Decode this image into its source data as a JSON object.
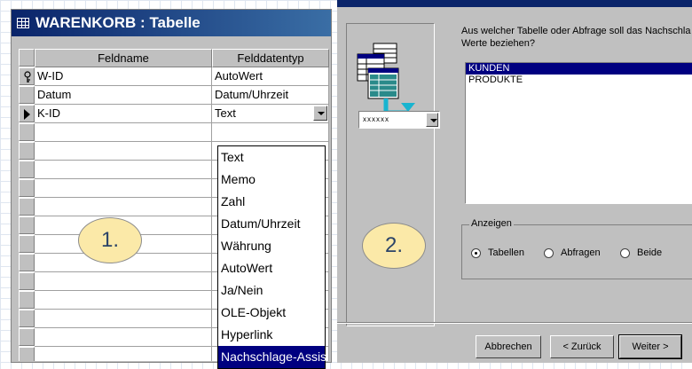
{
  "table_window": {
    "title": "WARENKORB : Tabelle",
    "columns": [
      "Feldname",
      "Felddatentyp"
    ],
    "rows": [
      {
        "feldname": "W-ID",
        "typ": "AutoWert",
        "primary_key": true
      },
      {
        "feldname": "Datum",
        "typ": "Datum/Uhrzeit",
        "primary_key": false
      },
      {
        "feldname": "K-ID",
        "typ": "Text",
        "primary_key": false,
        "current": true
      }
    ],
    "type_options": [
      "Text",
      "Memo",
      "Zahl",
      "Datum/Uhrzeit",
      "Währung",
      "AutoWert",
      "Ja/Nein",
      "OLE-Objekt",
      "Hyperlink",
      "Nachschlage-Assis"
    ],
    "highlighted_option": "Nachschlage-Assis"
  },
  "wizard": {
    "question": "Aus welcher Tabelle oder Abfrage soll das Nachschla Werte beziehen?",
    "list_items": [
      "KUNDEN",
      "PRODUKTE"
    ],
    "selected_item": "KUNDEN",
    "combo_placeholder": "xxxxxx",
    "group_label": "Anzeigen",
    "radio_options": [
      {
        "label": "Tabellen",
        "checked": true
      },
      {
        "label": "Abfragen",
        "checked": false
      },
      {
        "label": "Beide",
        "checked": false
      }
    ],
    "buttons": {
      "cancel": "Abbrechen",
      "back": "< Zurück",
      "next": "Weiter >"
    }
  },
  "badges": [
    "1.",
    "2."
  ],
  "colors": {
    "title_bar": "#0a246a",
    "selection": "#000080",
    "badge_fill": "#fbe9a8"
  }
}
